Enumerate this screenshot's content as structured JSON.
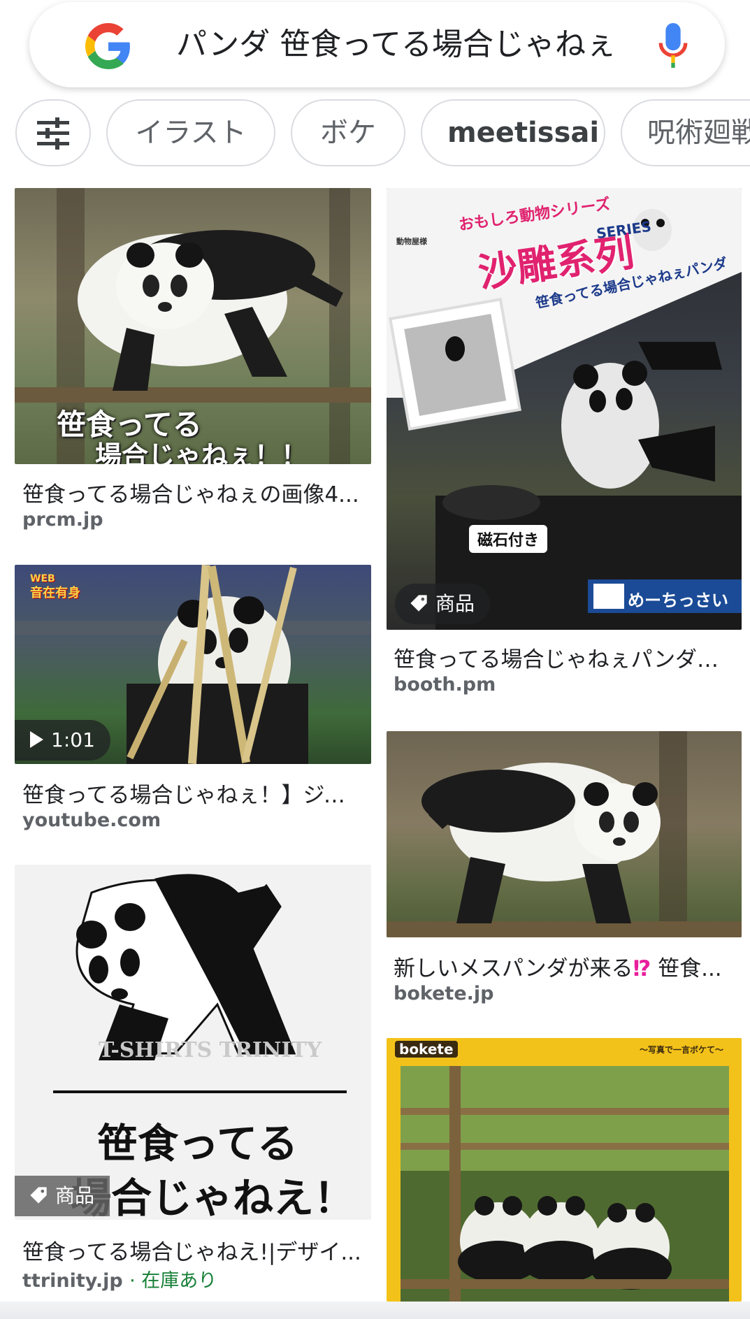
{
  "search": {
    "query": "パンダ 笹食ってる場合じゃねぇ"
  },
  "chips": [
    "イラスト",
    "ボケ",
    "meetissai",
    "呪術廻戦"
  ],
  "results": [
    {
      "caption": "笹食ってる場合じゃねぇの画像4...",
      "source": "prcm.jp",
      "overlay": [
        "笹食ってる",
        "場合じゃねぇ！！"
      ]
    },
    {
      "caption": "笹食ってる場合じゃねぇパンダ（...",
      "source": "booth.pm",
      "badge": "商品",
      "overlay": [
        "おもしろ動物シリーズ",
        "沙雕系列",
        "SERIES",
        "笹食ってる場合じゃねぇパンダ",
        "磁石付き",
        "めーちっさい",
        "動物屋様"
      ]
    },
    {
      "caption": "笹食ってる場合じゃねぇ！】ジャ...",
      "source": "youtube.com",
      "duration": "1:01",
      "overlay": [
        "WEB",
        "音在有身"
      ]
    },
    {
      "caption_prefix": "新しいメスパンダが来る",
      "caption_mark": "⁉",
      "caption_suffix": " 笹食...",
      "source": "bokete.jp"
    },
    {
      "caption": "笹食ってる場合じゃねえ!|デザイ...",
      "source": "ttrinity.jp",
      "stock": "· 在庫あり",
      "badge": "商品",
      "overlay": [
        "T-SHIRTS TRINITY",
        "笹食ってる",
        "場合じゃねえ！"
      ]
    },
    {
      "source": "bokete.jp",
      "overlay": [
        "bokete",
        "〜写真で一言ボケて〜"
      ]
    }
  ],
  "colors": {
    "google_blue": "#4285F4",
    "google_red": "#EA4335",
    "google_yellow": "#FBBC05",
    "google_green": "#34A853",
    "stock_green": "#188038",
    "question_pink": "#E91E9C"
  }
}
